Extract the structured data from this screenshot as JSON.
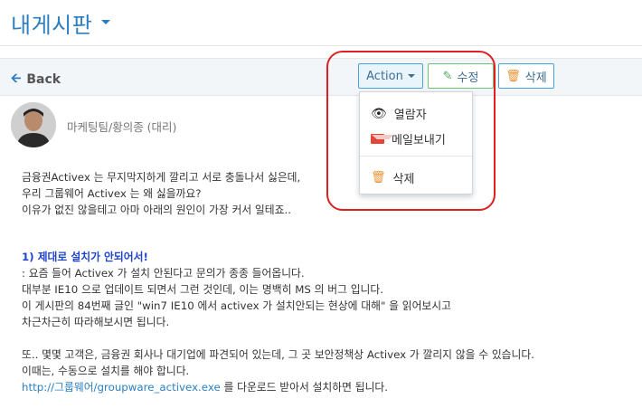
{
  "header": {
    "title": "내게시판"
  },
  "toolbar": {
    "back_label": "Back",
    "action_label": "Action",
    "edit_label": "수정",
    "delete_label": "삭제"
  },
  "post": {
    "author": "마케팅팀/황의종 (대리)",
    "lines": [
      "금융권Activex 는 무지막지하게 깔리고 서로 충돌나서 싫은데,",
      "우리 그룹웨어 Activex 는 왜 싫을까요?",
      "이유가 없진 않을테고 아마 아래의 원인이 가장 커서 일테죠..",
      "1) 제대로 설치가 안되어서!",
      ": 요즘 들어 Activex 가 설치 안된다고 문의가 종종 들어옵니다.",
      "대부분 IE10 으로 업데이트 되면서 그런 것인데,  이는 명백히 MS 의 버그 입니다.",
      "이 게시판의 84번째 글인 \"win7 IE10 에서 activex 가 설치안되는 현상에 대해\" 을 읽어보시고",
      "차근차근히 따라해보시면 됩니다.",
      "또.. 몇몇 고객은, 금융권 회사나 대기업에 파견되어 있는데, 그 곳 보안정책상 Activex 가 깔리지 않을 수 있습니다.",
      "이때는, 수동으로 설치를 해야 합니다.",
      "http://그룹웨어/groupware_activex.exe",
      " 를 다운로드 받아서 설치하면 됩니다."
    ]
  },
  "action_menu": {
    "items": [
      {
        "label": "열람자",
        "icon": "eye-icon"
      },
      {
        "label": "메일보내기",
        "icon": "mail-icon"
      },
      {
        "label": "삭제",
        "icon": "trash-icon"
      }
    ]
  },
  "colors": {
    "accent": "#2b7fc1",
    "section_title": "#1f44cc",
    "highlight_ring": "#e02020"
  }
}
